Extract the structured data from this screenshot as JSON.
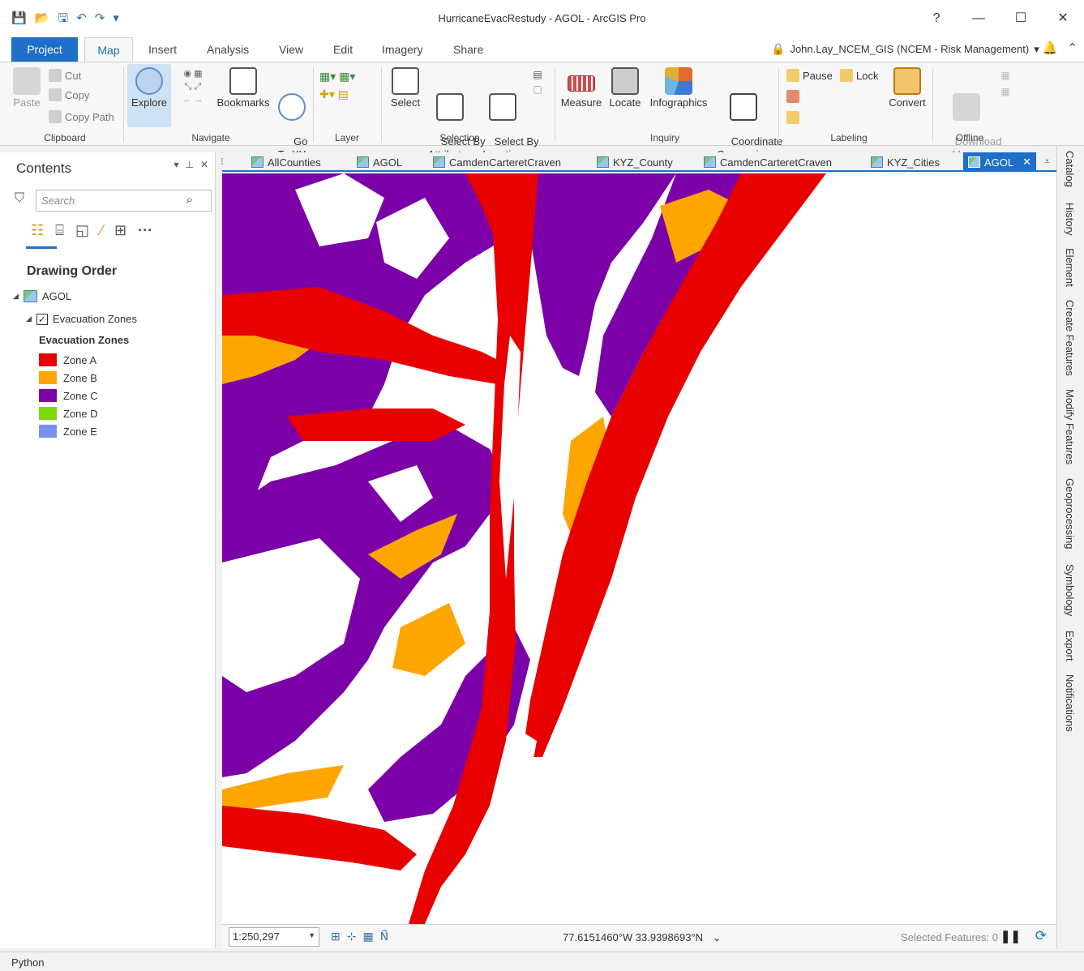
{
  "window": {
    "title": "HurricaneEvacRestudy - AGOL - ArcGIS Pro",
    "help": "?",
    "minimize": "—",
    "maximize": "☐",
    "close": "✕"
  },
  "qat": [
    "💾",
    "📂",
    "🖫",
    "↶",
    "↷",
    "▾"
  ],
  "ribbon_tabs": [
    "Project",
    "Map",
    "Insert",
    "Analysis",
    "View",
    "Edit",
    "Imagery",
    "Share"
  ],
  "user": {
    "label": "John.Lay_NCEM_GIS (NCEM - Risk Management)",
    "dropdown": "▾",
    "bell": "🔔",
    "collapse": "⌃"
  },
  "ribbon": {
    "clipboard": {
      "paste": "Paste",
      "cut": "Cut",
      "copy": "Copy",
      "copy_path": "Copy Path",
      "label": "Clipboard"
    },
    "navigate": {
      "explore": "Explore",
      "bookmarks": "Bookmarks",
      "go_to_xy": "Go\nTo XY",
      "label": "Navigate"
    },
    "layer": {
      "label": "Layer"
    },
    "selection": {
      "select": "Select",
      "select_by_attributes": "Select By\nAttributes",
      "select_by_location": "Select By\nLocation",
      "label": "Selection"
    },
    "inquiry": {
      "measure": "Measure",
      "locate": "Locate",
      "infographics": "Infographics",
      "coordinate_conversion": "Coordinate\nConversion",
      "label": "Inquiry"
    },
    "labeling": {
      "pause": "Pause",
      "lock": "Lock",
      "convert": "Convert",
      "label": "Labeling"
    },
    "offline": {
      "download_map": "Download\nMap ▾",
      "label": "Offline"
    }
  },
  "contents": {
    "title": "Contents",
    "search_placeholder": "Search",
    "drawing_order": "Drawing Order",
    "map_name": "AGOL",
    "layer_name": "Evacuation Zones",
    "legend_heading": "Evacuation Zones",
    "legend": [
      {
        "label": "Zone A",
        "color": "#e80000"
      },
      {
        "label": "Zone B",
        "color": "#ffa500"
      },
      {
        "label": "Zone C",
        "color": "#7b00a8"
      },
      {
        "label": "Zone D",
        "color": "#7fd900"
      },
      {
        "label": "Zone E",
        "color": "#7b8ff0"
      }
    ]
  },
  "doc_tabs": [
    {
      "label": "AllCounties",
      "active": false
    },
    {
      "label": "AGOL",
      "active": false
    },
    {
      "label": "CamdenCarteretCraven",
      "active": false
    },
    {
      "label": "KYZ_County",
      "active": false
    },
    {
      "label": "CamdenCarteretCraven",
      "active": false
    },
    {
      "label": "KYZ_Cities",
      "active": false
    },
    {
      "label": "AGOL",
      "active": true
    }
  ],
  "status": {
    "scale": "1:250,297",
    "coordinates": "77.6151460°W 33.9398693°N",
    "selected_features": "Selected Features: 0"
  },
  "right_dock": [
    "Catalog",
    "History",
    "Element",
    "Create Features",
    "Modify Features",
    "Geoprocessing",
    "Symbology",
    "Export",
    "Notifications"
  ],
  "bottom": {
    "python": "Python"
  }
}
